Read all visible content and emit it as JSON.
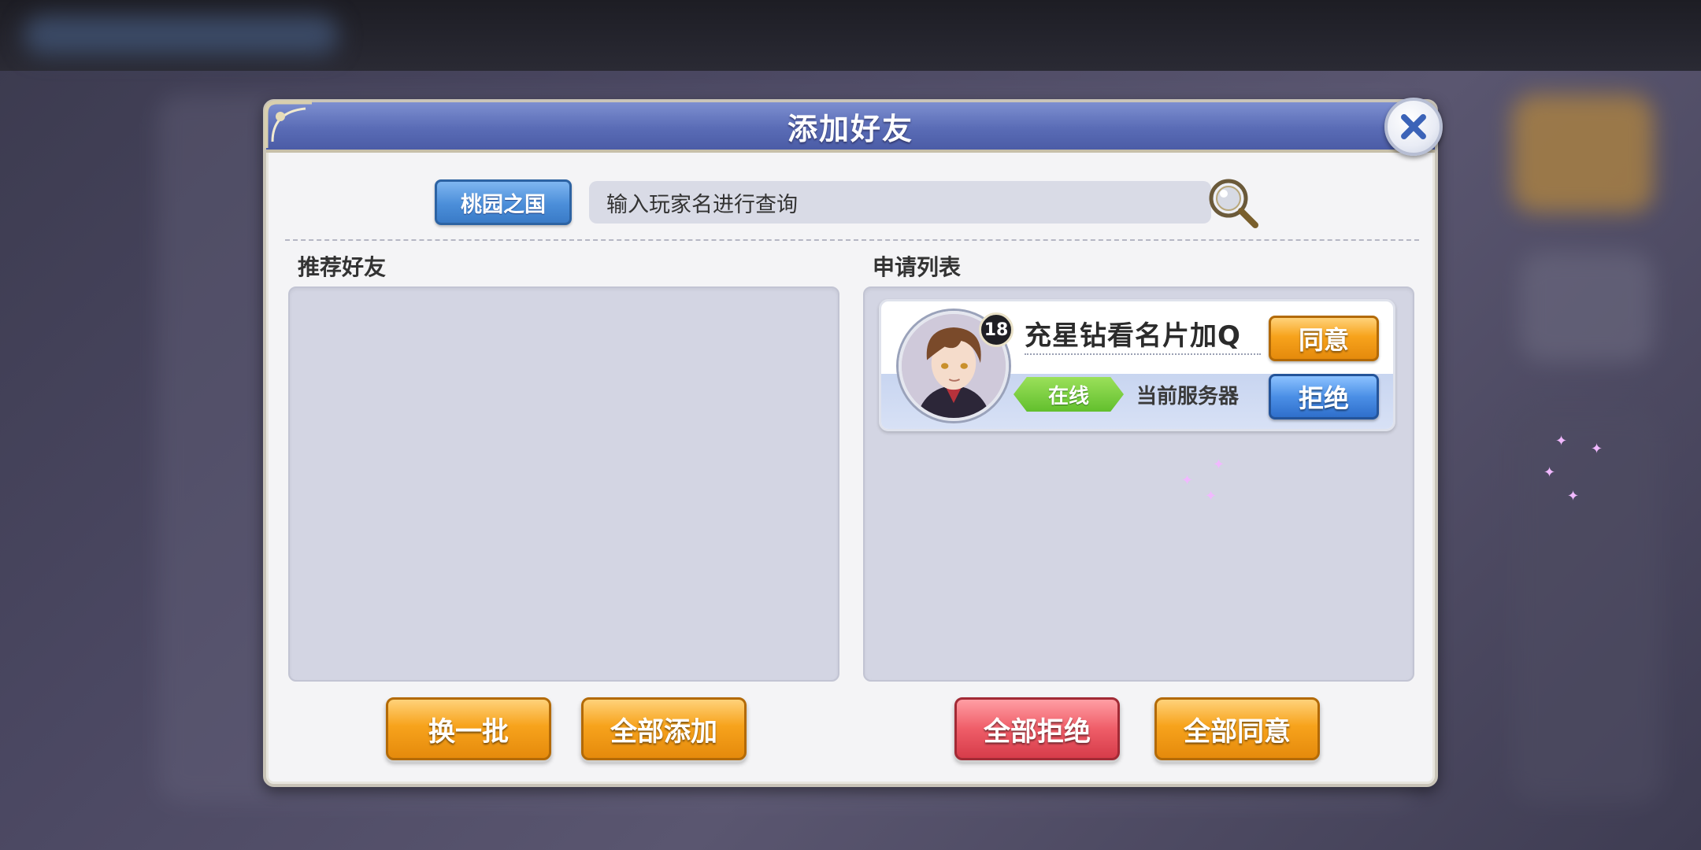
{
  "dialog": {
    "title": "添加好友"
  },
  "search": {
    "server_button": "桃园之国",
    "placeholder": "输入玩家名进行查询"
  },
  "recommended": {
    "title": "推荐好友"
  },
  "requests": {
    "title": "申请列表",
    "items": [
      {
        "level": "18",
        "name": "充星钻看名片加Q",
        "status": "在线",
        "server": "当前服务器",
        "accept_label": "同意",
        "reject_label": "拒绝"
      }
    ]
  },
  "footer": {
    "refresh_label": "换一批",
    "add_all_label": "全部添加",
    "reject_all_label": "全部拒绝",
    "accept_all_label": "全部同意"
  },
  "icons": {
    "close": "close-icon",
    "search": "magnifier-icon",
    "corner": "corner-ornament-icon"
  },
  "colors": {
    "header_blue": "#5a6cb6",
    "orange_button": "#f7a31c",
    "blue_button": "#4b8fe6",
    "red_button": "#ef5d68",
    "online_green": "#62bf2d"
  }
}
